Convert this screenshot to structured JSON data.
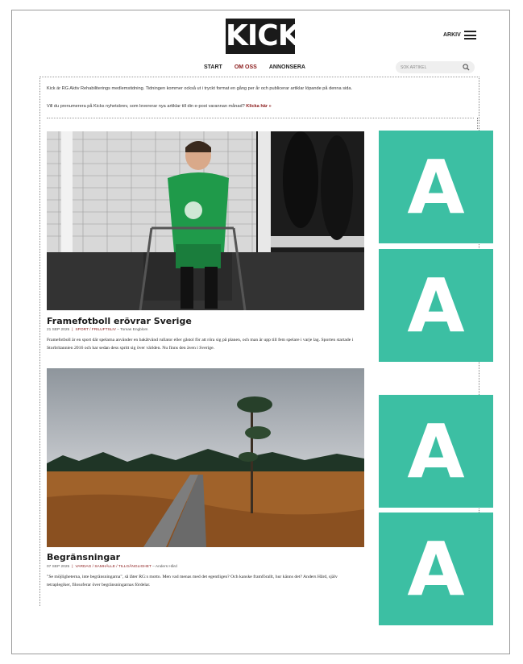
{
  "header": {
    "logo_text": "KICK",
    "archive_label": "ARKIV",
    "nav": [
      {
        "label": "START"
      },
      {
        "label": "OM OSS"
      },
      {
        "label": "ANNONSERA"
      }
    ],
    "search_placeholder": "SÖK ARTIKEL"
  },
  "intro": {
    "text": "Kick är RG Aktiv Rehabiliterings medlemstidning. Tidningen kommer också ut i tryckt format en gång per år och publicerar artiklar löpande på denna sida.",
    "newsletter_text": "Vill du prenumerera på Kicks nyhetsbrev, som levererar nya artiklar till din e-post varannan månad?",
    "newsletter_link": "Klicka här »"
  },
  "articles": [
    {
      "title": "Framefotboll erövrar Sverige",
      "date": "21 SEP 2025",
      "categories": "SPORT / FRILUFTSLIV",
      "author": "– Tomas Engblom",
      "excerpt": "Framefotboll är en sport där spelarna använder en bakåtvänd rullator eller gåstol för att röra sig på planen, och man är upp till fem spelare i varje lag. Sporten startade i Storbritannien 2016 och har sedan dess spritt sig över världen. Nu finns den även i Sverige."
    },
    {
      "title": "Begränsningar",
      "date": "07 SEP 2025",
      "categories": "VARDAG / SAMHÄLLE / TILLGÄNGLIGHET",
      "author": "– Anders Hård",
      "excerpt": "\"Se möjligheterna, inte begränsningarna\", så låter RG:s motto. Men vad menas med det egentligen? Och kanske framförallt, hur känns det? Anders Hård, själv tetraplegiker, filosoferar över begränsningarnas fördelar."
    }
  ],
  "ads": [
    {
      "letter": "A"
    },
    {
      "letter": "A"
    },
    {
      "letter": "A"
    },
    {
      "letter": "A"
    }
  ],
  "colors": {
    "accent": "#8a1a1a",
    "ad_green": "#3cbfa3",
    "logo_bg": "#1a1a1a"
  }
}
